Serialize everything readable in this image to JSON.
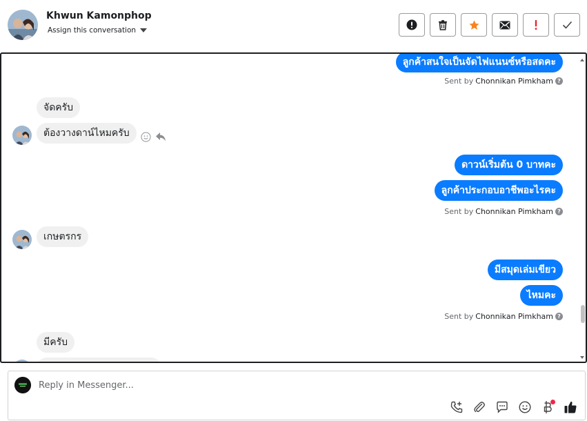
{
  "header": {
    "contact_name": "Khwun Kamonphop",
    "assign_label": "Assign this conversation",
    "actions": [
      {
        "name": "mark-spam-button",
        "icon": "exclamation-circle-icon"
      },
      {
        "name": "delete-button",
        "icon": "trash-icon"
      },
      {
        "name": "star-button",
        "icon": "star-icon"
      },
      {
        "name": "mark-unread-button",
        "icon": "envelope-icon"
      },
      {
        "name": "follow-up-button",
        "icon": "exclamation-icon"
      },
      {
        "name": "mark-done-button",
        "icon": "check-icon"
      }
    ]
  },
  "messages": [
    {
      "dir": "out",
      "text": "ลูกค้าสนใจเป็นจัดไฟแนนซ์หรือสดคะ"
    },
    {
      "dir": "meta",
      "prefix": "Sent by",
      "sender": "Chonnikan Pimkham"
    },
    {
      "dir": "in",
      "text": "จัดครับ"
    },
    {
      "dir": "in",
      "text": "ต้องวางดาน์ไหมครับ"
    },
    {
      "dir": "out",
      "text": "ดาวน์เริ่มต้น 0 บาทคะ"
    },
    {
      "dir": "out",
      "text": "ลูกค้าประกอบอาชีพอะไรคะ"
    },
    {
      "dir": "meta",
      "prefix": "Sent by",
      "sender": "Chonnikan Pimkham"
    },
    {
      "dir": "in",
      "text": "เกษตรกร"
    },
    {
      "dir": "out",
      "text": "มีสมุดเล่มเขียว"
    },
    {
      "dir": "out",
      "text": "ไหมคะ"
    },
    {
      "dir": "meta",
      "prefix": "Sent by",
      "sender": "Chonnikan Pimkham"
    },
    {
      "dir": "in",
      "text": "มีครับ"
    }
  ],
  "composer": {
    "placeholder": "Reply in Messenger...",
    "tools": [
      "phone-plus-icon",
      "paperclip-icon",
      "chat-bubble-icon",
      "smiley-icon",
      "baht-icon",
      "thumbs-up-icon"
    ]
  },
  "colors": {
    "outgoing_bubble": "#0a7cff",
    "incoming_bubble": "#f0f0f0",
    "star": "#f5841f",
    "follow_up": "#e4262d",
    "notification_dot": "#f02849"
  }
}
